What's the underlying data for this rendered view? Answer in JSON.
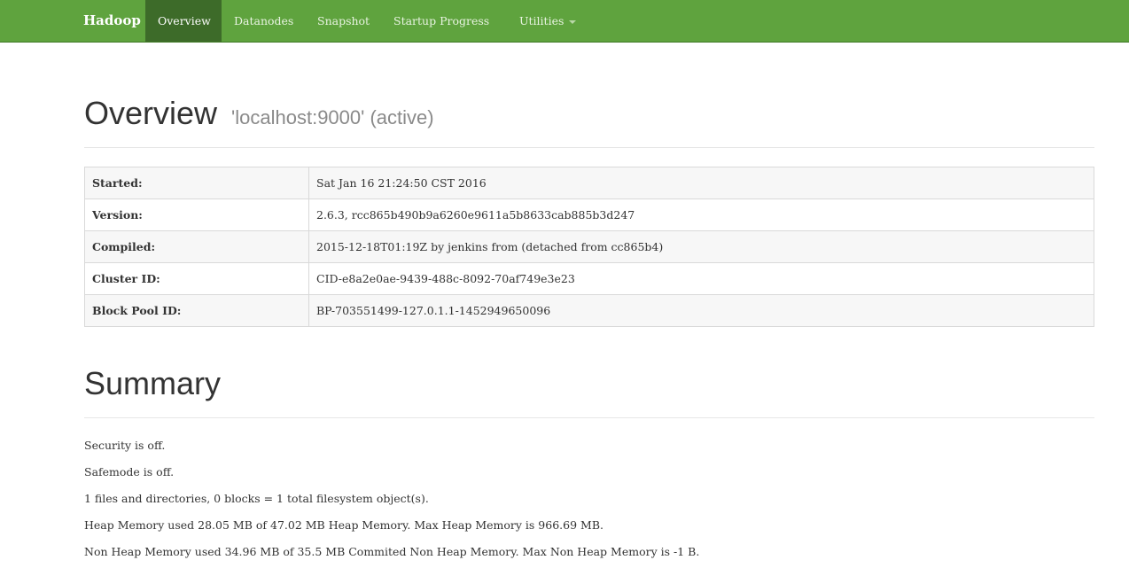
{
  "navbar": {
    "brand": "Hadoop",
    "items": [
      {
        "label": "Overview"
      },
      {
        "label": "Datanodes"
      },
      {
        "label": "Snapshot"
      },
      {
        "label": "Startup Progress"
      },
      {
        "label": "Utilities"
      }
    ],
    "active_item": "Overview"
  },
  "overview": {
    "title": "Overview",
    "subtitle": "'localhost:9000' (active)",
    "rows": [
      {
        "label": "Started:",
        "value": "Sat Jan 16 21:24:50 CST 2016"
      },
      {
        "label": "Version:",
        "value": "2.6.3, rcc865b490b9a6260e9611a5b8633cab885b3d247"
      },
      {
        "label": "Compiled:",
        "value": "2015-12-18T01:19Z by jenkins from (detached from cc865b4)"
      },
      {
        "label": "Cluster ID:",
        "value": "CID-e8a2e0ae-9439-488c-8092-70af749e3e23"
      },
      {
        "label": "Block Pool ID:",
        "value": "BP-703551499-127.0.1.1-1452949650096"
      }
    ]
  },
  "summary": {
    "title": "Summary",
    "lines": [
      "Security is off.",
      "Safemode is off.",
      "1 files and directories, 0 blocks = 1 total filesystem object(s).",
      "Heap Memory used 28.05 MB of 47.02 MB Heap Memory. Max Heap Memory is 966.69 MB.",
      "Non Heap Memory used 34.96 MB of 35.5 MB Commited Non Heap Memory. Max Non Heap Memory is -1 B."
    ]
  },
  "colors": {
    "navbar_bg": "#5fa33e",
    "navbar_active_bg": "#3d6b29"
  }
}
